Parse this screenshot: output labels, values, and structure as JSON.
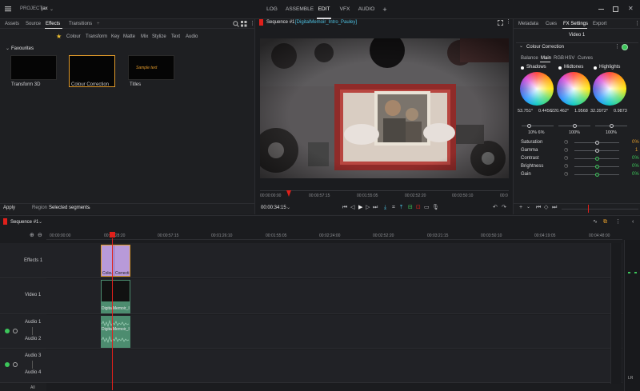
{
  "app": {
    "project_label": "PROJECT",
    "project_name": "jax",
    "workspace_tabs": [
      "LOG",
      "ASSEMBLE",
      "EDIT",
      "VFX",
      "AUDIO"
    ],
    "active_workspace": "EDIT",
    "add_tab": "+"
  },
  "left_panel": {
    "tabs": [
      "Assets",
      "Source",
      "Effects",
      "Transitions"
    ],
    "active_tab": "Effects",
    "add_tab": "+",
    "categories": [
      "Colour",
      "Transform",
      "Key",
      "Matte",
      "Mix",
      "Stylize",
      "Text",
      "Audio"
    ],
    "section_title": "Favourites",
    "effects": [
      {
        "label": "Transform 3D",
        "selected": false
      },
      {
        "label": "Colour Correction",
        "selected": true
      },
      {
        "label": "Titles",
        "selected": false,
        "preview_text": "Sample text"
      }
    ],
    "apply_label": "Apply",
    "region_label": "Region",
    "region_value": "Selected segments"
  },
  "viewer": {
    "sequence_label": "Sequence #1",
    "clip_name": "[DigitalMemoir_Intro_Pauley]",
    "ruler_ticks": [
      "00:00:00:00",
      "00:00:57:15",
      "00:01:55:05",
      "00:02:52:20",
      "00:03:50:10",
      "00:0"
    ],
    "timecode": "00:00:34:15"
  },
  "right_panel": {
    "tabs": [
      "Metadata",
      "Cues",
      "FX Settings",
      "Export"
    ],
    "active_tab": "FX Settings",
    "subtitle": "Video 1",
    "effect_name": "Colour Correction",
    "subtabs": [
      "Balance",
      "Main",
      "RGB",
      "HSV",
      "Curves"
    ],
    "active_subtab": "Main",
    "wheels": [
      {
        "label": "Shadows",
        "v1": "53.751°",
        "v2": "0.4456"
      },
      {
        "label": "Midtones",
        "v1": "220.462°",
        "v2": "1.9568"
      },
      {
        "label": "Highlights",
        "v1": "32.3972°",
        "v2": "0.9873"
      }
    ],
    "wheel_percents": [
      "10% 6%",
      "100%",
      "100%"
    ],
    "wheel_sliders": [
      0.45,
      1.0,
      1.0
    ],
    "params": [
      {
        "label": "Saturation",
        "value": "0%",
        "level": 0.5
      },
      {
        "label": "Gamma",
        "value": "1",
        "level": 0.5
      },
      {
        "label": "Contrast",
        "value": "0%",
        "level": 0.5
      },
      {
        "label": "Brightness",
        "value": "0%",
        "level": 0.5
      },
      {
        "label": "Gain",
        "value": "0%",
        "level": 0.5
      }
    ]
  },
  "timeline": {
    "sequence_label": "Sequence #1",
    "ruler_ticks": [
      "00:00:00:00",
      "00:00:28:20",
      "00:00:57:15",
      "00:01:26:10",
      "00:01:55:05",
      "00:02:24:00",
      "00:02:52:20",
      "00:03:21:15",
      "00:03:50:10",
      "00:04:19:05",
      "00:04:48:00"
    ],
    "tracks": [
      "Effects 1",
      "Video 1",
      "Audio 1",
      "Audio 2",
      "Audio 3",
      "Audio 4"
    ],
    "clips": {
      "effect_clip_a": "Colou",
      "effect_clip_b": "Correcti",
      "video_clip": "DigitalMemoir_In",
      "audio_clip": "DigitalMemoir_In"
    },
    "bottom_label": "All",
    "meter_label": "LR"
  },
  "colors": {
    "accent_red": "#e0201b",
    "accent_orange": "#e09a2a",
    "effect_clip": "#b89ad9",
    "audio_clip": "#4c8c6f",
    "active_green": "#3cc65a"
  }
}
